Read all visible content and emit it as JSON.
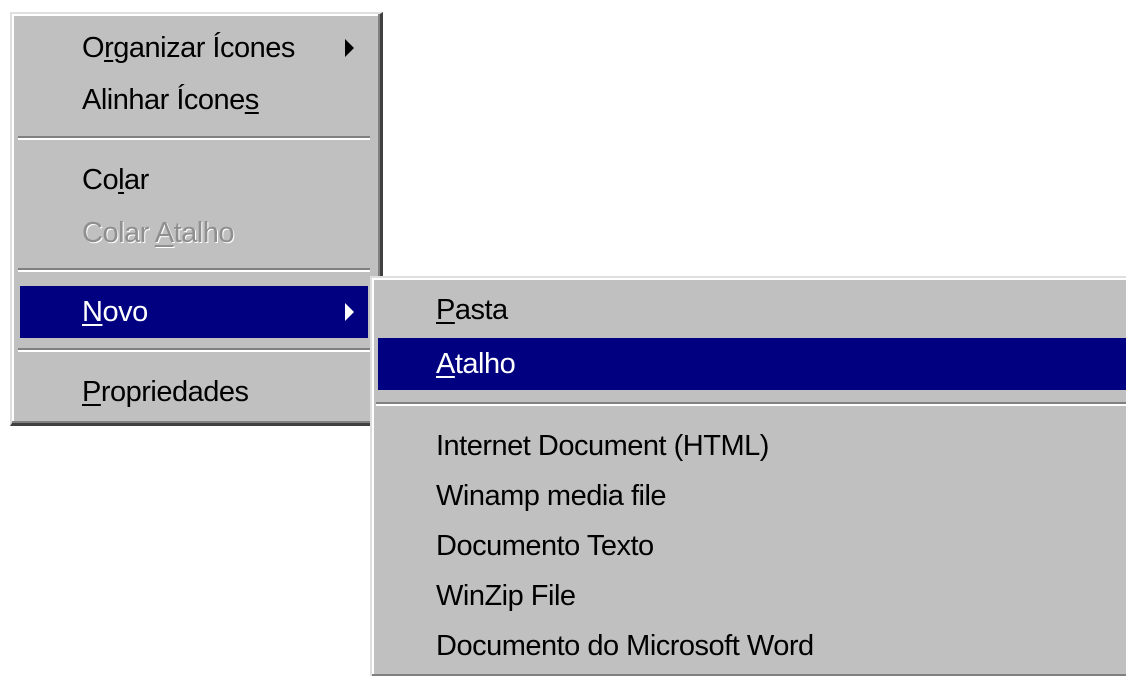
{
  "main_menu": {
    "items": [
      {
        "label_pre": "O",
        "label_key": "r",
        "label_post": "ganizar Ícones",
        "has_submenu": true
      },
      {
        "label_pre": "Alinhar Ícone",
        "label_key": "s",
        "label_post": ""
      },
      {
        "label_pre": "Co",
        "label_key": "l",
        "label_post": "ar"
      },
      {
        "label_pre": "Colar ",
        "label_key": "A",
        "label_post": "talho",
        "disabled": true
      },
      {
        "label_pre": "",
        "label_key": "N",
        "label_post": "ovo",
        "selected": true,
        "has_submenu": true
      },
      {
        "label_pre": "",
        "label_key": "P",
        "label_post": "ropriedades"
      }
    ]
  },
  "sub_menu": {
    "items": [
      {
        "label_pre": "",
        "label_key": "P",
        "label_post": "asta"
      },
      {
        "label_pre": "",
        "label_key": "A",
        "label_post": "talho",
        "selected": true
      },
      {
        "label": "Internet Document (HTML)"
      },
      {
        "label": "Winamp media file"
      },
      {
        "label": "Documento Texto"
      },
      {
        "label": "WinZip File"
      },
      {
        "label": "Documento do Microsoft Word"
      }
    ]
  },
  "colors": {
    "menu_bg": "#c0c0c0",
    "highlight_bg": "#000080",
    "highlight_fg": "#ffffff",
    "disabled_fg": "#8f8f8f"
  }
}
